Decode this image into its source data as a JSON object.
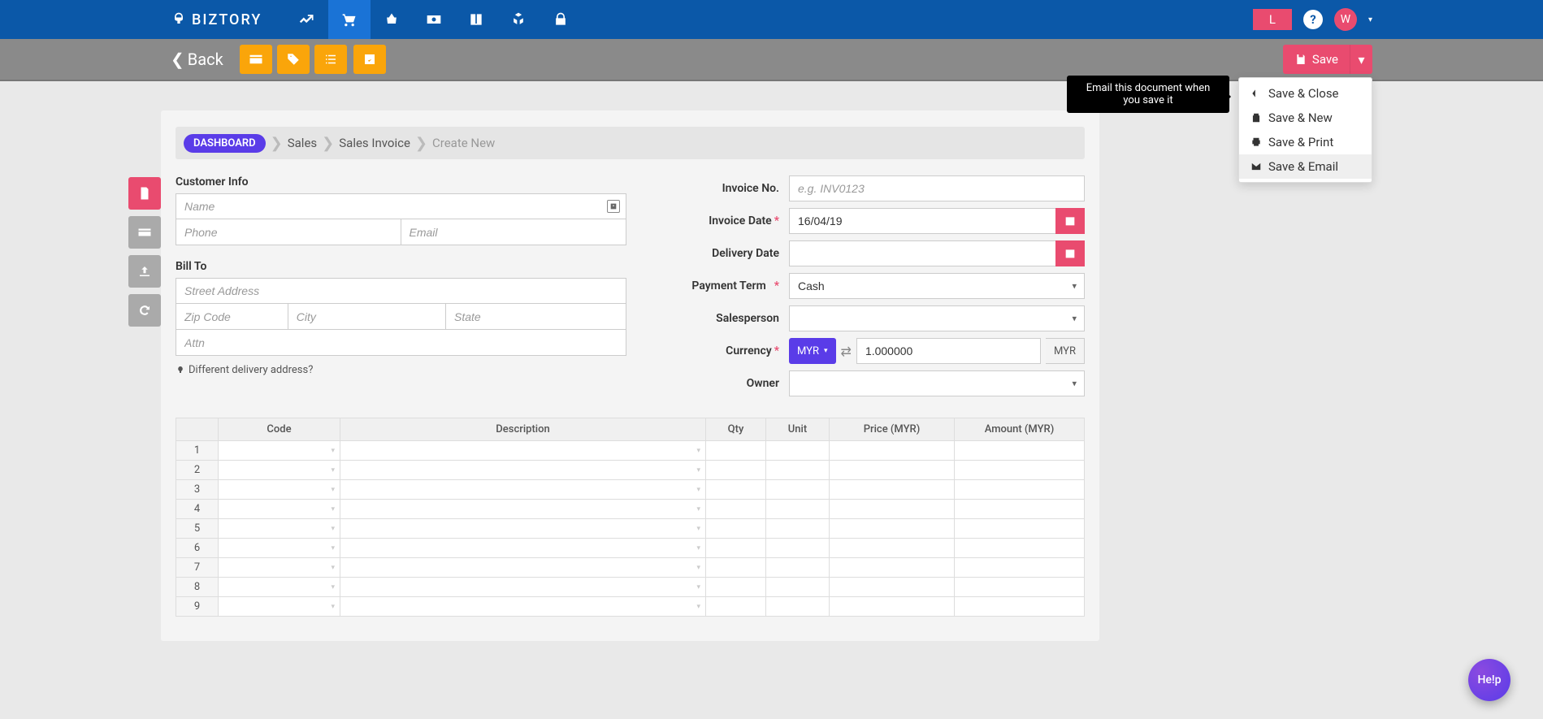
{
  "brand": "BIZTORY",
  "nav_badge": "L",
  "nav_help": "?",
  "nav_avatar": "W",
  "secbar": {
    "back": "Back",
    "save": "Save",
    "dropdown": [
      {
        "label": "Save & Close"
      },
      {
        "label": "Save & New"
      },
      {
        "label": "Save & Print"
      },
      {
        "label": "Save & Email"
      }
    ],
    "tooltip": "Email this document when you save it"
  },
  "breadcrumb": {
    "pill": "DASHBOARD",
    "items": [
      "Sales",
      "Sales Invoice"
    ],
    "current": "Create New"
  },
  "left": {
    "customer_info": "Customer Info",
    "name_ph": "Name",
    "phone_ph": "Phone",
    "email_ph": "Email",
    "bill_to": "Bill To",
    "street_ph": "Street Address",
    "zip_ph": "Zip Code",
    "city_ph": "City",
    "state_ph": "State",
    "attn_ph": "Attn",
    "diff_addr": "Different delivery address?"
  },
  "right": {
    "invoice_no": "Invoice No.",
    "invoice_no_ph": "e.g. INV0123",
    "invoice_date": "Invoice Date",
    "invoice_date_val": "16/04/19",
    "delivery_date": "Delivery Date",
    "payment_term": "Payment Term",
    "payment_term_val": "Cash",
    "salesperson": "Salesperson",
    "currency": "Currency",
    "currency_btn": "MYR",
    "rate_val": "1.000000",
    "currency_suffix": "MYR",
    "owner": "Owner"
  },
  "table": {
    "headers": {
      "code": "Code",
      "desc": "Description",
      "qty": "Qty",
      "unit": "Unit",
      "price": "Price (MYR)",
      "amount": "Amount (MYR)"
    },
    "rows": [
      "1",
      "2",
      "3",
      "4",
      "5",
      "6",
      "7",
      "8",
      "9"
    ]
  },
  "help": "He!p"
}
